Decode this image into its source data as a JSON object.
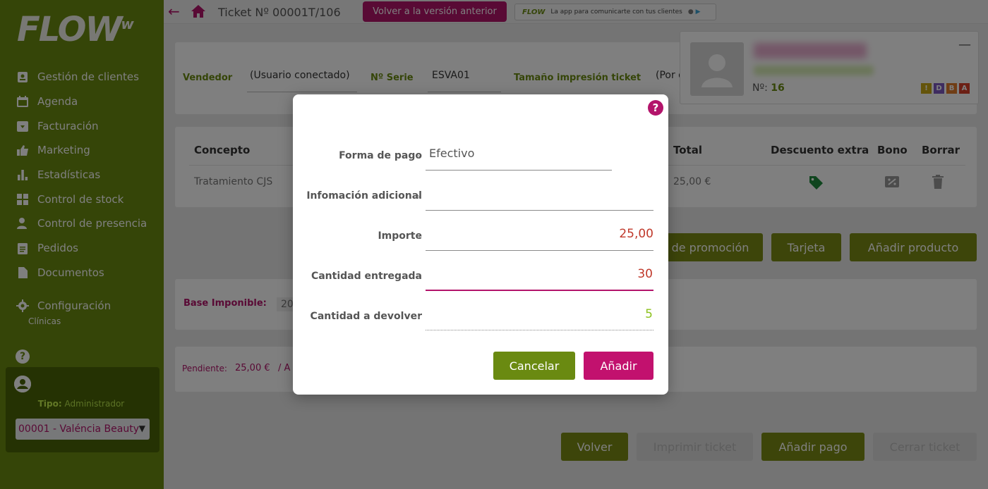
{
  "brand": {
    "logo_text": "FLOW",
    "logo_sup": "w",
    "accent": "#6a8a11",
    "primary": "#b3146b"
  },
  "sidebar": {
    "items": [
      {
        "label": "Gestión de clientes",
        "icon": "clients-badge-icon"
      },
      {
        "label": "Agenda",
        "icon": "calendar-icon"
      },
      {
        "label": "Facturación",
        "icon": "billing-icon"
      },
      {
        "label": "Marketing",
        "icon": "thumbs-up-icon"
      },
      {
        "label": "Estadísticas",
        "icon": "bar-chart-icon"
      },
      {
        "label": "Control de stock",
        "icon": "stock-icon"
      },
      {
        "label": "Control de presencia",
        "icon": "presence-icon"
      },
      {
        "label": "Pedidos",
        "icon": "clipboard-icon"
      },
      {
        "label": "Documentos",
        "icon": "document-icon"
      }
    ],
    "config_label": "Configuración",
    "config_sub": "Clínicas",
    "help": "?",
    "user": {
      "type_label": "Tipo:",
      "type_value": "Administrador",
      "clinic": "00001 - Valéncia Beauty"
    }
  },
  "topbar": {
    "title": "Ticket Nº 00001T/106",
    "prev_version": "Volver a la versión anterior",
    "app_banner_logo": "FLOW",
    "app_banner": "La app para comunicarte con tus clientes"
  },
  "seller": {
    "vendedor_label": "Vendedor",
    "vendedor_value": "(Usuario conectado)",
    "serie_label": "Nº Serie",
    "serie_value": "ESVA01",
    "size_label": "Tamaño impresión ticket",
    "size_value": "(Por d"
  },
  "client": {
    "num_label": "Nº:",
    "num_value": "16",
    "badges": [
      "!",
      "D",
      "B",
      "A"
    ]
  },
  "table": {
    "headers": {
      "concepto": "Concepto",
      "total": "Total",
      "descuento": "Descuento extra",
      "bono": "Bono",
      "borrar": "Borrar"
    },
    "row": {
      "concepto": "Tratamiento CJS",
      "total": "25,00 €"
    }
  },
  "actions": {
    "promocion": "de promoción",
    "tarjeta": "Tarjeta",
    "producto": "Añadir producto"
  },
  "summary": {
    "base_label": "Base Imponible:",
    "base_value": "20,",
    "pendiente_label": "Pendiente:",
    "pendiente_value": "25,00 €",
    "pendiente_sep": "/ A"
  },
  "footer": {
    "volver": "Volver",
    "imprimir": "Imprimir ticket",
    "anadir_pago": "Añadir pago",
    "cerrar": "Cerrar ticket"
  },
  "dialog": {
    "forma_pago_label": "Forma de pago",
    "forma_pago_value": "Efectivo",
    "info_label": "Infomación adicional",
    "info_value": "",
    "importe_label": "Importe",
    "importe_value": "25,00",
    "entregada_label": "Cantidad entregada",
    "entregada_value": "30",
    "devolver_label": "Cantidad a devolver",
    "devolver_value": "5",
    "cancel": "Cancelar",
    "add": "Añadir",
    "help": "?"
  }
}
